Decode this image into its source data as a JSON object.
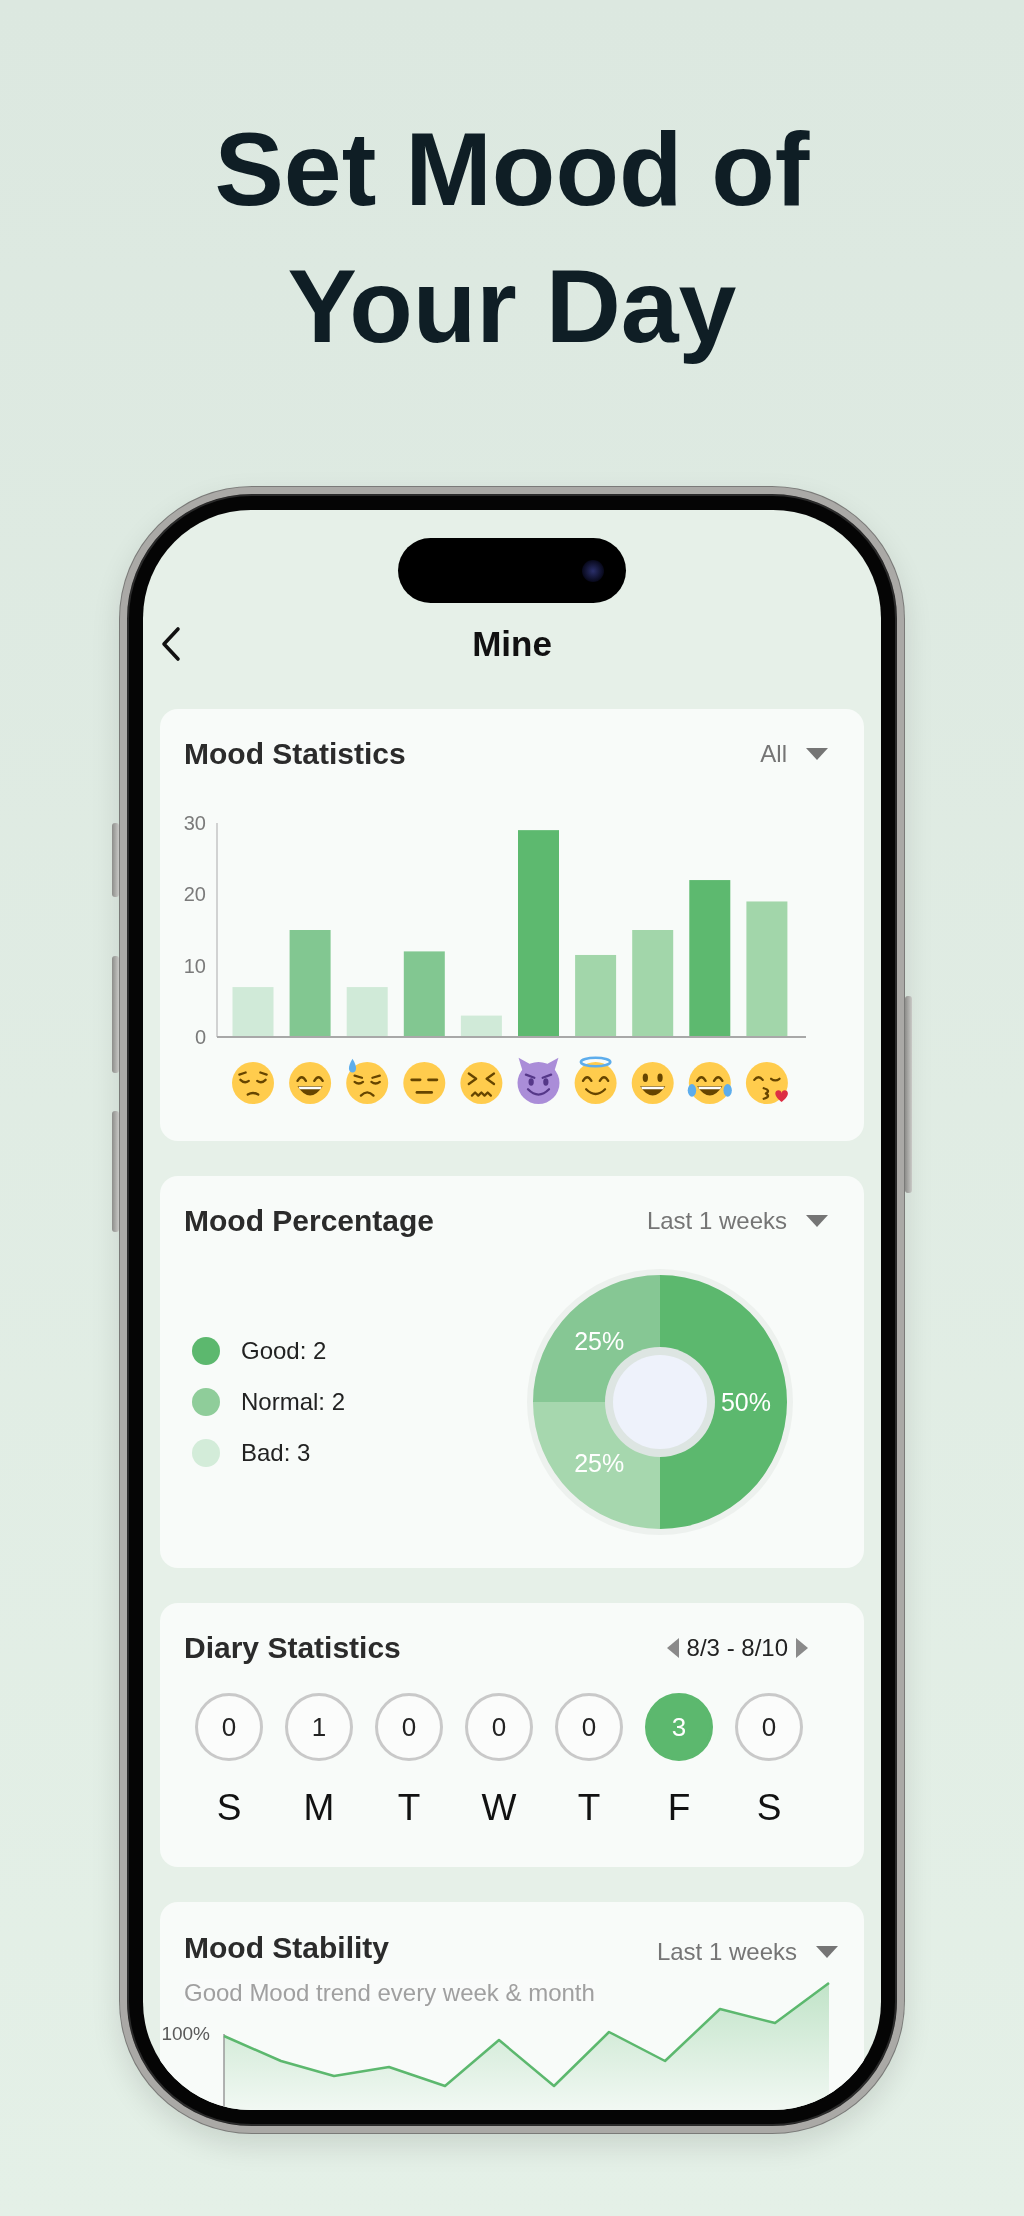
{
  "headline": "Set Mood of Your Day",
  "header": {
    "title": "Mine"
  },
  "mood_statistics": {
    "title": "Mood Statistics",
    "filter": "All",
    "chart_data": {
      "type": "bar",
      "ylim": [
        0,
        30
      ],
      "yticks": [
        0,
        10,
        20,
        30
      ],
      "series": [
        {
          "values": [
            7,
            15,
            7,
            12,
            3,
            29,
            11.5,
            15,
            22,
            19
          ],
          "colors": [
            "#d0ead8",
            "#82c791",
            "#d0ead8",
            "#82c791",
            "#d0ead8",
            "#5db96f",
            "#a2d6aa",
            "#a2d6aa",
            "#5db96f",
            "#a2d6aa"
          ]
        }
      ]
    },
    "emojis": [
      {
        "kind": "pensive"
      },
      {
        "kind": "grinning"
      },
      {
        "kind": "sweat"
      },
      {
        "kind": "expressionless"
      },
      {
        "kind": "confounded"
      },
      {
        "kind": "devil"
      },
      {
        "kind": "halo"
      },
      {
        "kind": "smiley"
      },
      {
        "kind": "tears_of_joy"
      },
      {
        "kind": "kissing"
      }
    ]
  },
  "mood_percentage": {
    "title": "Mood Percentage",
    "filter": "Last 1 weeks",
    "legend": [
      {
        "label": "Good: 2",
        "color": "#5cb86e"
      },
      {
        "label": "Normal: 2",
        "color": "#8fcd9a"
      },
      {
        "label": "Bad: 3",
        "color": "#d3ecd9"
      }
    ],
    "chart_data": {
      "type": "donut",
      "values": [
        50,
        25,
        25
      ],
      "colors": [
        "#5cb86e",
        "#a6d7ae",
        "#86c794"
      ],
      "value_labels": [
        "50%",
        "25%",
        "25%"
      ]
    }
  },
  "diary_statistics": {
    "title": "Diary Statistics",
    "date_range": "8/3 - 8/10",
    "days": [
      {
        "count": "0",
        "day": "S",
        "selected": false
      },
      {
        "count": "1",
        "day": "M",
        "selected": false
      },
      {
        "count": "0",
        "day": "T",
        "selected": false
      },
      {
        "count": "0",
        "day": "W",
        "selected": false
      },
      {
        "count": "0",
        "day": "T",
        "selected": false
      },
      {
        "count": "3",
        "day": "F",
        "selected": true
      },
      {
        "count": "0",
        "day": "S",
        "selected": false
      }
    ]
  },
  "mood_stability": {
    "title": "Mood Stability",
    "filter": "Last 1 weeks",
    "subtitle": "Good Mood trend every week & month",
    "y_label": "100%"
  }
}
